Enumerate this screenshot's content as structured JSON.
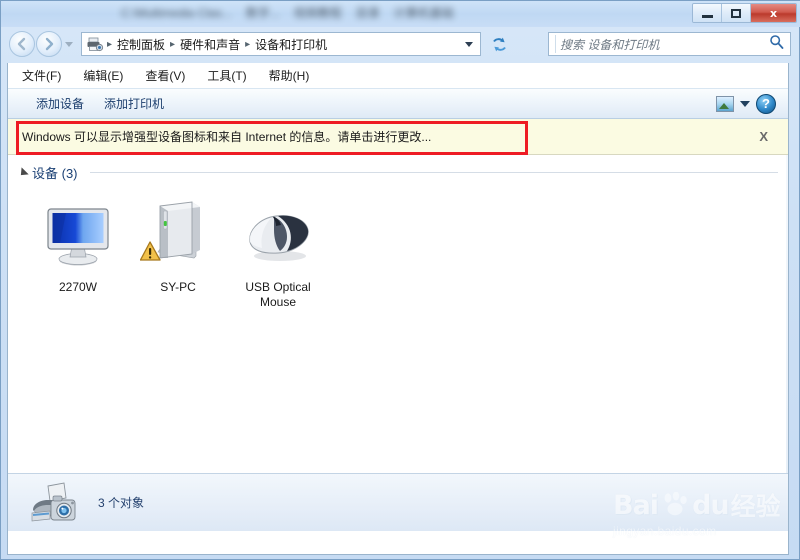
{
  "window": {
    "title_blurred_segments": [
      "C:\\Multimedia Clas...",
      "数字...",
      "视频教程",
      "目录",
      "计算机基础"
    ],
    "controls": {
      "minimize": "minimize-button",
      "maximize": "maximize-button",
      "close": "close-button",
      "close_glyph": "x"
    }
  },
  "navigation": {
    "back_label": "←",
    "forward_label": "→",
    "recent_pages_caret": "▾",
    "breadcrumb": [
      "控制面板",
      "硬件和声音",
      "设备和打印机"
    ],
    "breadcrumb_separator": "▸",
    "address_caret": "▾",
    "refresh_label": "refresh"
  },
  "search": {
    "placeholder": "搜索 设备和打印机",
    "icon": "search-icon"
  },
  "menubar": {
    "items": [
      {
        "label": "文件(F)"
      },
      {
        "label": "编辑(E)"
      },
      {
        "label": "查看(V)"
      },
      {
        "label": "工具(T)"
      },
      {
        "label": "帮助(H)"
      }
    ]
  },
  "commandbar": {
    "add_device": "添加设备",
    "add_printer": "添加打印机",
    "view_icon": "view-options-icon",
    "view_caret": "▾",
    "help_label": "?"
  },
  "infobar": {
    "message": "Windows 可以显示增强型设备图标和来自 Internet 的信息。请单击进行更改...",
    "close_label": "X",
    "background": "#fbfbe2",
    "highlight_color": "#ee1c24"
  },
  "content": {
    "group": {
      "label": "设备 (3)",
      "expanded": true
    },
    "devices": [
      {
        "name": "2270W",
        "icon": "monitor-icon",
        "has_warning": false
      },
      {
        "name": "SY-PC",
        "icon": "computer-icon",
        "has_warning": true
      },
      {
        "name": "USB Optical Mouse",
        "icon": "mouse-icon",
        "has_warning": false
      }
    ]
  },
  "statusbar": {
    "text": "3 个对象",
    "icon": "devices-and-printers-icon"
  },
  "watermark": {
    "brand_bai": "Bai",
    "brand_du": "du",
    "brand_cn": "经验",
    "url": "jingyan.baidu.com"
  }
}
